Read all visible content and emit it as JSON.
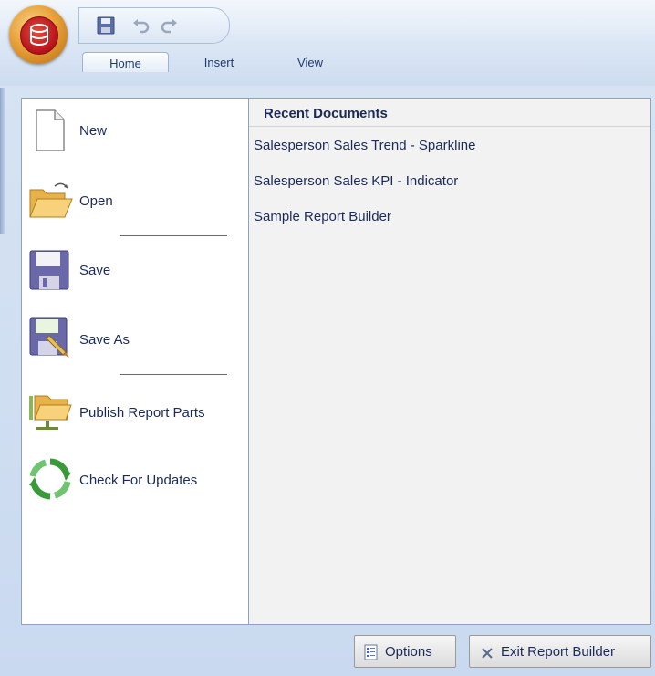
{
  "titlebar": {
    "quick_access": [
      {
        "icon": "save-icon"
      },
      {
        "icon": "undo-icon"
      },
      {
        "icon": "redo-icon"
      }
    ],
    "tabs": [
      {
        "label": "Home",
        "active": true
      },
      {
        "label": "Insert",
        "active": false
      },
      {
        "label": "View",
        "active": false
      }
    ]
  },
  "menu": {
    "items": [
      {
        "label": "New",
        "icon": "new-document-icon"
      },
      {
        "label": "Open",
        "icon": "open-folder-icon"
      },
      {
        "label": "Save",
        "icon": "save-disk-icon"
      },
      {
        "label": "Save As",
        "icon": "save-as-icon"
      },
      {
        "label": "Publish Report Parts",
        "icon": "publish-folder-icon"
      },
      {
        "label": "Check For Updates",
        "icon": "refresh-arrows-icon"
      }
    ]
  },
  "recent": {
    "title": "Recent Documents",
    "items": [
      "Salesperson Sales Trend - Sparkline",
      "Salesperson Sales KPI - Indicator",
      "Sample Report Builder"
    ]
  },
  "footer": {
    "options_label": "Options",
    "exit_label": "Exit Report Builder"
  },
  "colors": {
    "frame": "#c9d9ef",
    "text": "#1c2a5a",
    "orb": "#e9a23a"
  }
}
